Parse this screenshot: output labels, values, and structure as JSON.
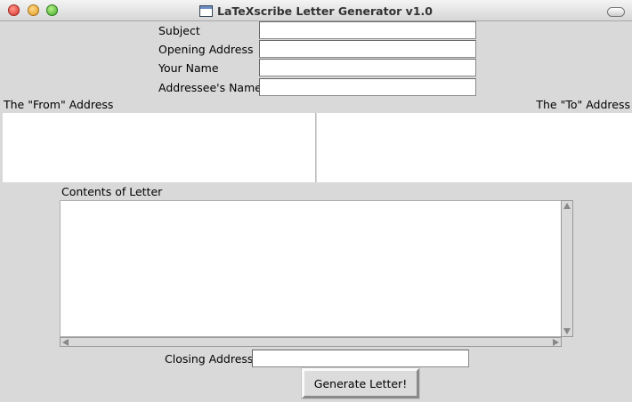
{
  "window": {
    "title": "LaTeXscribe Letter Generator v1.0"
  },
  "form": {
    "subject_label": "Subject",
    "subject_value": "",
    "opening_address_label": "Opening Address",
    "opening_address_value": "",
    "your_name_label": "Your Name",
    "your_name_value": "",
    "addressee_name_label": "Addressee's Name",
    "addressee_name_value": "",
    "from_address_label": "The \"From\" Address",
    "from_address_value": "",
    "to_address_label": "The \"To\" Address",
    "to_address_value": "",
    "contents_label": "Contents of Letter",
    "contents_value": "",
    "closing_address_label": "Closing Address",
    "closing_address_value": ""
  },
  "actions": {
    "generate_label": "Generate Letter!"
  },
  "colors": {
    "window_bg": "#d9d9d9",
    "field_bg": "#ffffff"
  }
}
